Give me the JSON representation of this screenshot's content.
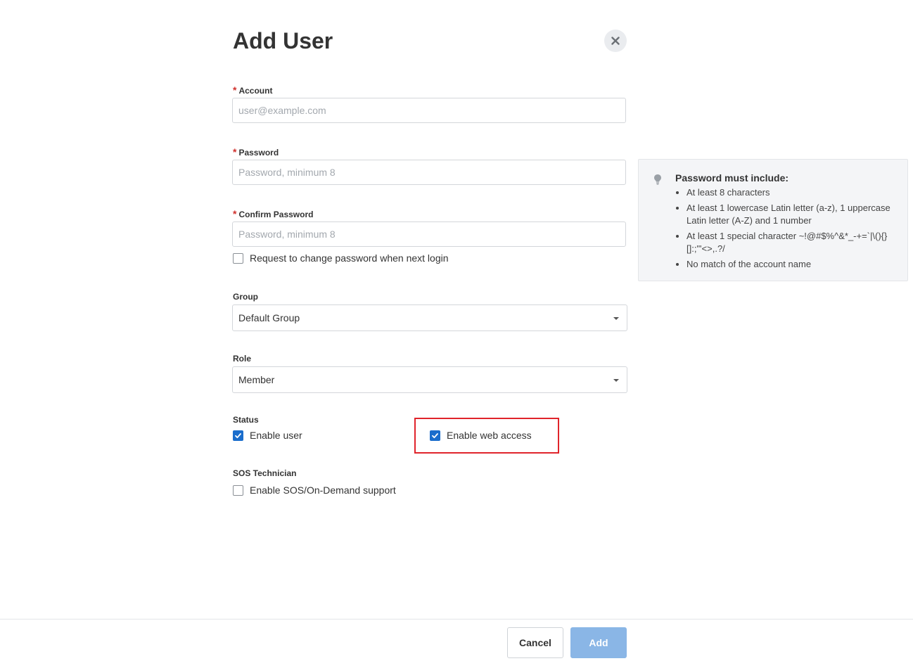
{
  "dialog": {
    "title": "Add User"
  },
  "form": {
    "required_mark": "*",
    "account": {
      "label": "Account",
      "placeholder": "user@example.com",
      "value": ""
    },
    "password": {
      "label": "Password",
      "placeholder": "Password, minimum 8",
      "value": ""
    },
    "confirm_password": {
      "label": "Confirm Password",
      "placeholder": "Password, minimum 8",
      "value": ""
    },
    "request_change": {
      "label": "Request to change password when next login",
      "checked": false
    },
    "group": {
      "label": "Group",
      "selected": "Default Group"
    },
    "role": {
      "label": "Role",
      "selected": "Member"
    },
    "status": {
      "label": "Status",
      "enable_user": {
        "label": "Enable user",
        "checked": true
      },
      "enable_web_access": {
        "label": "Enable web access",
        "checked": true
      }
    },
    "sos": {
      "label": "SOS Technician",
      "enable_sos": {
        "label": "Enable SOS/On-Demand support",
        "checked": false
      }
    }
  },
  "password_hint": {
    "title": "Password must include:",
    "rules": [
      "At least 8 characters",
      "At least 1 lowercase Latin letter (a-z), 1 uppercase Latin letter (A-Z) and 1 number",
      "At least 1 special character ~!@#$%^&*_-+=`|\\(){}[]:;\"'<>,.?/",
      "No match of the account name"
    ]
  },
  "footer": {
    "cancel_label": "Cancel",
    "add_label": "Add"
  },
  "colors": {
    "accent": "#1a6dcc",
    "add_button_disabled": "#8ab6e6",
    "required": "#d0312d",
    "highlight": "#e0242b"
  }
}
